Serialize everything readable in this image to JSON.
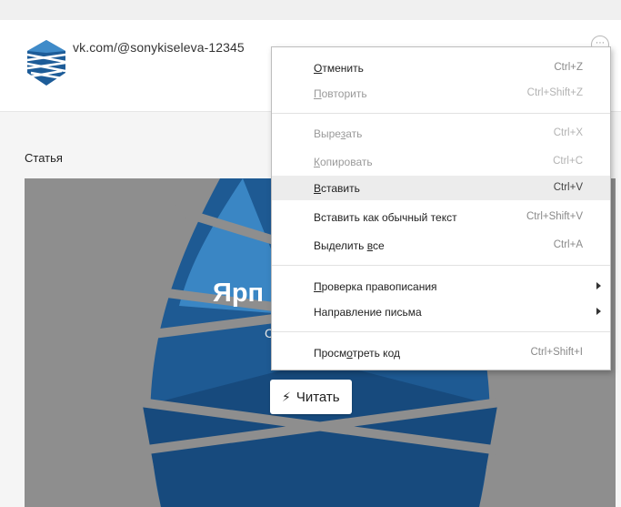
{
  "header": {
    "url": "vk.com/@sonykiseleva-12345",
    "more_glyph": "⋯"
  },
  "section_label": "Статья",
  "article": {
    "title_visible": "Ярп",
    "subtitle_visible": "С",
    "read_button": "Читать",
    "read_icon": "lightning-icon"
  },
  "context_menu": {
    "items": [
      {
        "label_u": "О",
        "label_rest": "тменить",
        "shortcut": "Ctrl+Z",
        "state": "enabled"
      },
      {
        "label_u": "П",
        "label_rest": "овторить",
        "shortcut": "Ctrl+Shift+Z",
        "state": "disabled"
      },
      {
        "label_pre": "Выре",
        "label_u": "з",
        "label_rest": "ать",
        "shortcut": "Ctrl+X",
        "state": "disabled"
      },
      {
        "label_u": "К",
        "label_rest": "опировать",
        "shortcut": "Ctrl+C",
        "state": "disabled"
      },
      {
        "label_u": "В",
        "label_rest": "ставить",
        "shortcut": "Ctrl+V",
        "state": "hover"
      },
      {
        "label": "Вставить как обычный текст",
        "shortcut": "Ctrl+Shift+V",
        "state": "enabled"
      },
      {
        "label_pre": "Выделить ",
        "label_u": "в",
        "label_rest": "се",
        "shortcut": "Ctrl+A",
        "state": "enabled"
      },
      {
        "label_u": "П",
        "label_rest": "роверка правописания",
        "submenu": true
      },
      {
        "label": "Направление письма",
        "submenu": true
      },
      {
        "label_pre": "Просм",
        "label_u": "о",
        "label_rest": "треть код",
        "shortcut": "Ctrl+Shift+I",
        "state": "enabled"
      }
    ]
  },
  "colors": {
    "card_bg": "#8e8e8e",
    "logo_blue": "#1d5c98",
    "menu_hover": "#ececec"
  }
}
